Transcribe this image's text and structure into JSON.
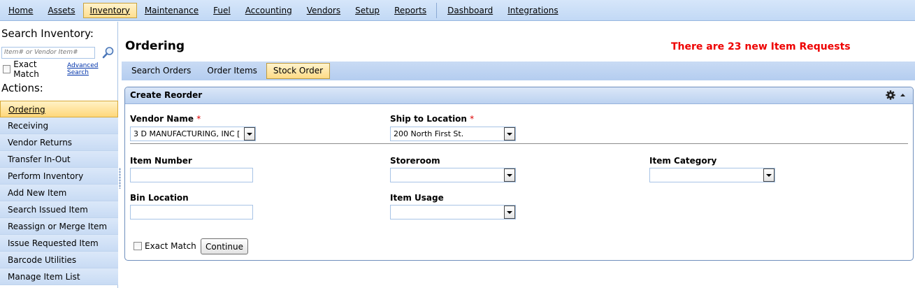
{
  "topnav": {
    "items": [
      "Home",
      "Assets",
      "Inventory",
      "Maintenance",
      "Fuel",
      "Accounting",
      "Vendors",
      "Setup",
      "Reports"
    ],
    "items_right": [
      "Dashboard",
      "Integrations"
    ],
    "active": "Inventory"
  },
  "sidebar": {
    "search_title": "Search Inventory:",
    "search_placeholder": "Item# or Vendor Item#",
    "exact_match": "Exact Match",
    "advanced_search": "Advanced Search",
    "actions_title": "Actions:",
    "actions": [
      "Ordering",
      "Receiving",
      "Vendor Returns",
      "Transfer In-Out",
      "Perform Inventory",
      "Add New Item",
      "Search Issued Item",
      "Reassign or Merge Item",
      "Issue Requested Item",
      "Barcode Utilities",
      "Manage Item List"
    ],
    "active_action": "Ordering"
  },
  "main": {
    "title": "Ordering",
    "alert": "There are 23 new Item Requests",
    "tabs": [
      "Search Orders",
      "Order Items",
      "Stock Order"
    ],
    "active_tab": "Stock Order"
  },
  "panel": {
    "title": "Create Reorder",
    "vendor_label": "Vendor Name",
    "vendor_value": "3 D MANUFACTURING, INC [",
    "ship_label": "Ship to Location",
    "ship_value": "200 North First St.",
    "required_mark": "*",
    "item_number_label": "Item Number",
    "storeroom_label": "Storeroom",
    "item_category_label": "Item Category",
    "bin_location_label": "Bin Location",
    "item_usage_label": "Item Usage",
    "exact_match": "Exact Match",
    "continue_label": "Continue"
  },
  "colors": {
    "accent_active": "#ffdf8f",
    "nav_bg": "#c2d9f5",
    "alert": "#ee0000"
  }
}
